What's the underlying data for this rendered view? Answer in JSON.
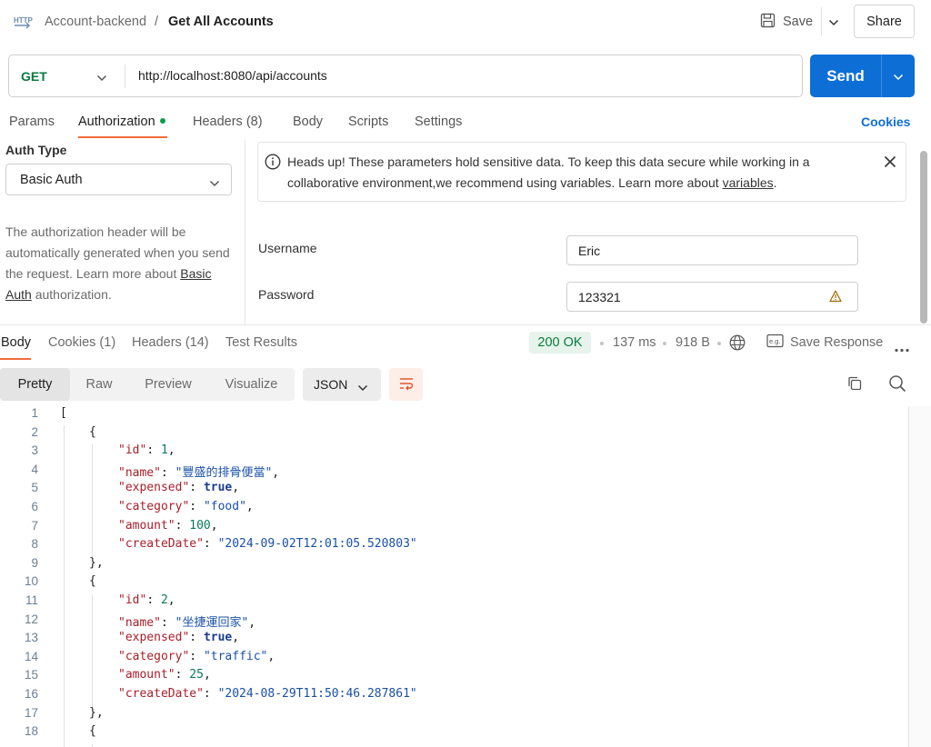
{
  "header": {
    "breadcrumb_parent": "Account-backend",
    "breadcrumb_sep": "/",
    "breadcrumb_current": "Get All Accounts",
    "save_label": "Save",
    "share_label": "Share"
  },
  "request": {
    "method": "GET",
    "url": "http://localhost:8080/api/accounts",
    "send_label": "Send"
  },
  "req_tabs": {
    "params": "Params",
    "authorization": "Authorization",
    "headers": "Headers",
    "headers_count": "(8)",
    "body": "Body",
    "scripts": "Scripts",
    "settings": "Settings",
    "cookies": "Cookies"
  },
  "auth": {
    "type_label": "Auth Type",
    "type_value": "Basic Auth",
    "desc_1": "The authorization header will be automatically generated when you send the request. Learn more about ",
    "desc_link": "Basic Auth",
    "desc_2": " authorization.",
    "alert_1": "Heads up! These parameters hold sensitive data. To keep this data secure while working in a collaborative environment,we recommend using variables. Learn more about ",
    "alert_link": "variables",
    "alert_2": ".",
    "username_label": "Username",
    "username_value": "Eric",
    "password_label": "Password",
    "password_value": "123321"
  },
  "response": {
    "tabs": {
      "body": "Body",
      "cookies": "Cookies",
      "cookies_count": "(1)",
      "headers": "Headers",
      "headers_count": "(14)",
      "test_results": "Test Results"
    },
    "status": "200 OK",
    "time": "137 ms",
    "size": "918 B",
    "save_response": "Save Response",
    "views": {
      "pretty": "Pretty",
      "raw": "Raw",
      "preview": "Preview",
      "visualize": "Visualize",
      "format": "JSON"
    }
  },
  "code_lines": [
    {
      "n": "1"
    },
    {
      "n": "2"
    },
    {
      "n": "3"
    },
    {
      "n": "4"
    },
    {
      "n": "5"
    },
    {
      "n": "6"
    },
    {
      "n": "7"
    },
    {
      "n": "8"
    },
    {
      "n": "9"
    },
    {
      "n": "10"
    },
    {
      "n": "11"
    },
    {
      "n": "12"
    },
    {
      "n": "13"
    },
    {
      "n": "14"
    },
    {
      "n": "15"
    },
    {
      "n": "16"
    },
    {
      "n": "17"
    },
    {
      "n": "18"
    }
  ],
  "records": [
    {
      "id": "1",
      "name": "\"豐盛的排骨便當\"",
      "expensed": "true",
      "category": "\"food\"",
      "amount": "100",
      "createDate": "\"2024-09-02T12:01:05.520803\""
    },
    {
      "id": "2",
      "name": "\"坐捷運回家\"",
      "expensed": "true",
      "category": "\"traffic\"",
      "amount": "25",
      "createDate": "\"2024-08-29T11:50:46.287861\""
    }
  ],
  "keys": {
    "id": "\"id\"",
    "name": "\"name\"",
    "expensed": "\"expensed\"",
    "category": "\"category\"",
    "amount": "\"amount\"",
    "createDate": "\"createDate\""
  },
  "punct": {
    "open_bracket": "[",
    "open_brace": "{",
    "close_brace_comma": "},",
    "colon": ": ",
    "comma": ","
  },
  "colors": {
    "accent_blue": "#0d6fd6",
    "tab_underline": "#f26b3a",
    "status_green": "#0a7a3e"
  }
}
